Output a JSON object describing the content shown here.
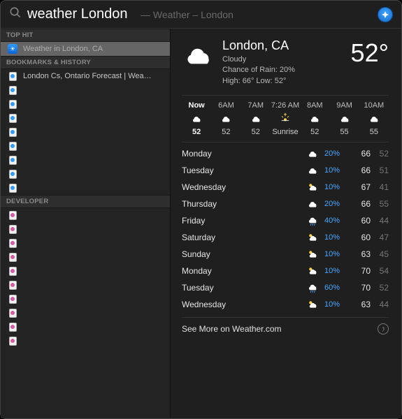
{
  "search": {
    "query": "weather London",
    "completion": "— Weather – London"
  },
  "sidebar": {
    "sections": {
      "topHit": {
        "header": "TOP HIT",
        "item": "Weather in London, CA"
      },
      "bookmarks": {
        "header": "BOOKMARKS & HISTORY",
        "items": [
          "London Cs, Ontario Forecast | Wea…",
          "",
          "",
          "",
          "",
          "",
          "",
          "",
          ""
        ]
      },
      "developer": {
        "header": "DEVELOPER",
        "items": [
          "",
          "",
          "",
          "",
          "",
          "",
          "",
          "",
          "",
          ""
        ]
      }
    }
  },
  "weather": {
    "location": "London, CA",
    "condition": "Cloudy",
    "chanceLabel": "Chance of Rain: 20%",
    "hiloLabel": "High: 66°  Low: 52°",
    "currentTemp": "52°",
    "hourly": [
      {
        "time": "Now",
        "icon": "cloud",
        "value": "52",
        "now": true
      },
      {
        "time": "6AM",
        "icon": "cloud",
        "value": "52"
      },
      {
        "time": "7AM",
        "icon": "cloud",
        "value": "52"
      },
      {
        "time": "7:26 AM",
        "icon": "sunrise",
        "value": "Sunrise"
      },
      {
        "time": "8AM",
        "icon": "cloud",
        "value": "52"
      },
      {
        "time": "9AM",
        "icon": "cloud",
        "value": "55"
      },
      {
        "time": "10AM",
        "icon": "cloud",
        "value": "55"
      }
    ],
    "daily": [
      {
        "day": "Monday",
        "icon": "cloud",
        "precip": "20%",
        "hi": "66",
        "lo": "52"
      },
      {
        "day": "Tuesday",
        "icon": "cloud",
        "precip": "10%",
        "hi": "66",
        "lo": "51"
      },
      {
        "day": "Wednesday",
        "icon": "partcloud",
        "precip": "10%",
        "hi": "67",
        "lo": "41"
      },
      {
        "day": "Thursday",
        "icon": "cloud",
        "precip": "20%",
        "hi": "66",
        "lo": "55"
      },
      {
        "day": "Friday",
        "icon": "rain",
        "precip": "40%",
        "hi": "60",
        "lo": "44"
      },
      {
        "day": "Saturday",
        "icon": "partcloud",
        "precip": "10%",
        "hi": "60",
        "lo": "47"
      },
      {
        "day": "Sunday",
        "icon": "partcloud",
        "precip": "10%",
        "hi": "63",
        "lo": "45"
      },
      {
        "day": "Monday",
        "icon": "partcloud",
        "precip": "10%",
        "hi": "70",
        "lo": "54"
      },
      {
        "day": "Tuesday",
        "icon": "rain",
        "precip": "60%",
        "hi": "70",
        "lo": "52"
      },
      {
        "day": "Wednesday",
        "icon": "partcloud",
        "precip": "10%",
        "hi": "63",
        "lo": "44"
      }
    ],
    "seeMore": "See More on Weather.com"
  }
}
